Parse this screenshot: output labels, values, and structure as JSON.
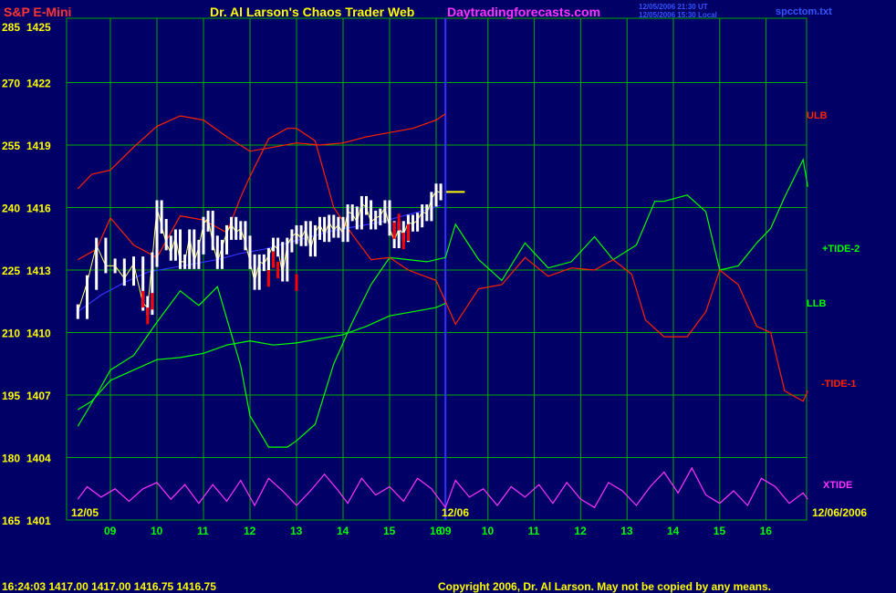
{
  "header": {
    "symbol": "S&P E-Mini",
    "title": "Dr. Al Larson's Chaos Trader Web",
    "site": "Daytradingforecasts.com",
    "stamp_line1": "12/05/2006 21:30 UT",
    "stamp_line2": "12/05/2006 15:30 Local",
    "file": "spcctom.txt"
  },
  "footer": {
    "quote": "16:24:03  1417.00 1417.00 1416.75 1416.75",
    "copyright": "Copyright 2006, Dr. Al Larson. May not be copied by any means."
  },
  "colors": {
    "background": "#000066",
    "grid": "#00aa00",
    "day_divider": "#3333ff",
    "ulb": "#ff2200",
    "llb": "#00ff00",
    "tide1": "#ff2200",
    "tide2": "#00ff00",
    "xtide": "#ff33ff",
    "moving_average": "#3333ff",
    "price": "#ffffff",
    "price_down": "#ff0000"
  },
  "chart_data": {
    "type": "line",
    "y_axis_left_outer": [
      285,
      270,
      255,
      240,
      225,
      210,
      195,
      180,
      165
    ],
    "y_axis_left_inner": [
      1425,
      1422,
      1419,
      1416,
      1413,
      1410,
      1407,
      1404,
      1401
    ],
    "ylim_price": [
      1401,
      1425
    ],
    "x_ticks_day1": [
      "09",
      "10",
      "11",
      "12",
      "13",
      "14",
      "15",
      "16"
    ],
    "x_ticks_day2": [
      "09",
      "10",
      "11",
      "12",
      "13",
      "14",
      "15",
      "16"
    ],
    "x_positions_hours": [
      9,
      10,
      11,
      12,
      13,
      14,
      15,
      16
    ],
    "date_day1": "12/05",
    "date_day2": "12/06",
    "date_end": "12/06/2006",
    "last_price": 1416.75,
    "labels": {
      "ulb": "ULB",
      "tide2": "+TIDE-2",
      "llb": "LLB",
      "tide1": "-TIDE-1",
      "xtide": "XTIDE"
    },
    "series": [
      {
        "name": "ULB",
        "x": [
          8.3,
          8.6,
          9.0,
          9.5,
          10.0,
          10.5,
          11.0,
          11.5,
          12.0,
          12.5,
          13.0,
          13.5,
          14.0,
          14.5,
          15.0,
          15.5,
          16.0,
          16.2
        ],
        "values": [
          1416.9,
          1417.6,
          1417.8,
          1418.9,
          1419.9,
          1420.4,
          1420.2,
          1419.4,
          1418.7,
          1418.9,
          1419.1,
          1419.0,
          1419.1,
          1419.4,
          1419.6,
          1419.8,
          1420.2,
          1420.5
        ]
      },
      {
        "name": "LLB",
        "x": [
          8.3,
          8.6,
          9.0,
          9.5,
          10.0,
          10.5,
          11.0,
          11.5,
          12.0,
          12.5,
          13.0,
          13.5,
          14.0,
          14.5,
          15.0,
          15.5,
          16.0,
          16.2
        ],
        "values": [
          1406.3,
          1406.7,
          1407.7,
          1408.2,
          1408.7,
          1408.8,
          1409.0,
          1409.4,
          1409.6,
          1409.4,
          1409.5,
          1409.7,
          1409.9,
          1410.3,
          1410.8,
          1411.0,
          1411.2,
          1411.4
        ]
      },
      {
        "name": "+TIDE-2",
        "x": [
          8.3,
          8.7,
          9.0,
          9.5,
          10.0,
          10.5,
          10.9,
          11.3,
          11.8,
          12.0,
          12.4,
          12.8,
          13.0,
          13.4,
          13.8,
          14.2,
          14.6,
          15.0,
          15.4,
          15.8,
          16.2,
          16.5,
          17.0,
          17.5,
          18.0,
          18.5,
          19.0,
          19.5,
          19.9,
          20.4,
          20.8,
          21.0,
          21.5,
          21.9,
          22.2,
          22.6,
          23.0,
          23.3,
          23.6,
          24.0,
          24.1
        ],
        "values": [
          1405.5,
          1407.0,
          1408.2,
          1408.9,
          1410.5,
          1412.0,
          1411.3,
          1412.2,
          1408.4,
          1406.0,
          1404.5,
          1404.5,
          1404.8,
          1405.6,
          1408.5,
          1410.5,
          1412.3,
          1413.6,
          1413.5,
          1413.4,
          1413.6,
          1415.2,
          1413.5,
          1412.5,
          1414.3,
          1413.1,
          1413.4,
          1414.6,
          1413.5,
          1414.2,
          1416.3,
          1416.3,
          1416.6,
          1415.8,
          1413.0,
          1413.2,
          1414.3,
          1415.0,
          1416.5,
          1418.3,
          1417.0
        ]
      },
      {
        "name": "-TIDE-1",
        "x": [
          8.3,
          8.7,
          9.0,
          9.5,
          10.0,
          10.5,
          11.0,
          11.5,
          11.8,
          12.0,
          12.4,
          12.8,
          13.0,
          13.4,
          13.8,
          14.2,
          14.6,
          15.0,
          15.4,
          16.0,
          16.5,
          17.0,
          17.5,
          18.0,
          18.5,
          19.0,
          19.5,
          19.9,
          20.3,
          20.6,
          21.0,
          21.5,
          21.9,
          22.2,
          22.6,
          23.0,
          23.3,
          23.6,
          24.0,
          24.1
        ],
        "values": [
          1413.5,
          1414.0,
          1415.5,
          1414.2,
          1413.6,
          1415.6,
          1415.4,
          1414.8,
          1416.5,
          1417.5,
          1419.3,
          1419.8,
          1419.8,
          1419.2,
          1416.0,
          1414.7,
          1413.5,
          1413.6,
          1413.0,
          1412.5,
          1410.4,
          1412.1,
          1412.3,
          1413.6,
          1412.7,
          1413.1,
          1413.0,
          1413.5,
          1412.8,
          1410.6,
          1409.8,
          1409.8,
          1411.0,
          1413.0,
          1412.3,
          1410.3,
          1410.0,
          1407.2,
          1406.7,
          1407.2
        ]
      },
      {
        "name": "XTIDE",
        "x": [
          8.3,
          8.5,
          8.8,
          9.1,
          9.4,
          9.7,
          10.0,
          10.3,
          10.6,
          10.9,
          11.2,
          11.5,
          11.8,
          12.1,
          12.4,
          12.7,
          13.0,
          13.3,
          13.6,
          13.9,
          14.1,
          14.4,
          14.7,
          15.0,
          15.3,
          15.6,
          15.9,
          16.2,
          16.5,
          16.8,
          17.1,
          17.4,
          17.7,
          18.0,
          18.3,
          18.6,
          18.9,
          19.2,
          19.5,
          19.8,
          20.1,
          20.4,
          20.7,
          21.0,
          21.3,
          21.6,
          21.9,
          22.2,
          22.5,
          22.8,
          23.1,
          23.4,
          23.7,
          24.0,
          24.1
        ],
        "values": [
          1402.0,
          1402.6,
          1402.1,
          1402.5,
          1401.9,
          1402.5,
          1402.8,
          1402.0,
          1402.7,
          1401.8,
          1402.7,
          1401.9,
          1402.9,
          1401.7,
          1403.0,
          1402.4,
          1401.7,
          1402.4,
          1403.2,
          1402.4,
          1401.8,
          1403.0,
          1402.2,
          1402.6,
          1401.9,
          1403.0,
          1402.5,
          1401.6,
          1402.9,
          1402.1,
          1402.5,
          1401.7,
          1402.6,
          1402.1,
          1402.7,
          1401.8,
          1402.8,
          1402.0,
          1401.6,
          1402.8,
          1402.4,
          1401.7,
          1402.6,
          1403.3,
          1402.3,
          1403.5,
          1402.2,
          1401.8,
          1402.4,
          1401.7,
          1403.0,
          1402.6,
          1401.8,
          1402.3,
          1402.0
        ]
      },
      {
        "name": "MA",
        "x": [
          8.3,
          8.8,
          9.3,
          9.8,
          10.3,
          10.8,
          11.3,
          11.8,
          12.3,
          12.8,
          13.3,
          13.8,
          14.3,
          14.8,
          15.3,
          15.8,
          16.1
        ],
        "values": [
          1411.0,
          1411.8,
          1412.4,
          1412.9,
          1413.1,
          1413.3,
          1413.5,
          1413.8,
          1414.0,
          1414.3,
          1414.6,
          1414.9,
          1415.1,
          1415.3,
          1415.6,
          1415.9,
          1416.1
        ]
      },
      {
        "name": "Price",
        "x": [
          8.3,
          8.5,
          8.7,
          8.9,
          9.1,
          9.3,
          9.5,
          9.7,
          9.8,
          9.9,
          10.0,
          10.1,
          10.2,
          10.3,
          10.4,
          10.5,
          10.6,
          10.7,
          10.8,
          10.9,
          11.0,
          11.1,
          11.2,
          11.3,
          11.4,
          11.5,
          11.6,
          11.7,
          11.8,
          11.9,
          12.0,
          12.1,
          12.2,
          12.3,
          12.4,
          12.5,
          12.6,
          12.7,
          12.8,
          12.9,
          13.0,
          13.1,
          13.2,
          13.3,
          13.4,
          13.5,
          13.6,
          13.7,
          13.8,
          13.9,
          14.0,
          14.1,
          14.2,
          14.3,
          14.4,
          14.5,
          14.6,
          14.7,
          14.8,
          14.9,
          15.0,
          15.1,
          15.2,
          15.3,
          15.4,
          15.5,
          15.6,
          15.7,
          15.8,
          15.9,
          16.0,
          16.1
        ],
        "values": [
          1411.0,
          1412.4,
          1414.2,
          1413.2,
          1413.2,
          1412.6,
          1413.3,
          1411.4,
          1411.2,
          1413.5,
          1416.0,
          1415.1,
          1414.3,
          1413.8,
          1414.6,
          1413.4,
          1413.4,
          1414.6,
          1413.4,
          1414.1,
          1415.2,
          1415.5,
          1414.3,
          1413.4,
          1414.1,
          1414.8,
          1415.2,
          1414.8,
          1415.0,
          1414.3,
          1413.4,
          1412.4,
          1413.4,
          1413.3,
          1413.7,
          1414.2,
          1414.0,
          1412.8,
          1414.2,
          1414.6,
          1414.8,
          1414.5,
          1415.0,
          1414.0,
          1414.8,
          1415.2,
          1414.7,
          1415.3,
          1414.9,
          1415.2,
          1414.7,
          1415.8,
          1415.7,
          1415.3,
          1416.2,
          1416.0,
          1415.3,
          1415.5,
          1415.6,
          1416.0,
          1415.0,
          1414.4,
          1415.0,
          1414.7,
          1415.3,
          1415.2,
          1415.4,
          1415.8,
          1415.7,
          1416.4,
          1416.8,
          1416.7
        ]
      },
      {
        "name": "Price-Down",
        "x": [
          9.7,
          9.8,
          9.9,
          12.4,
          12.5,
          12.6,
          13.0,
          15.1,
          15.2,
          15.3,
          15.4
        ],
        "values": [
          1411.6,
          1410.8,
          1411.5,
          1412.6,
          1413.5,
          1413.0,
          1412.4,
          1414.9,
          1415.3,
          1414.4,
          1414.8
        ]
      }
    ]
  }
}
